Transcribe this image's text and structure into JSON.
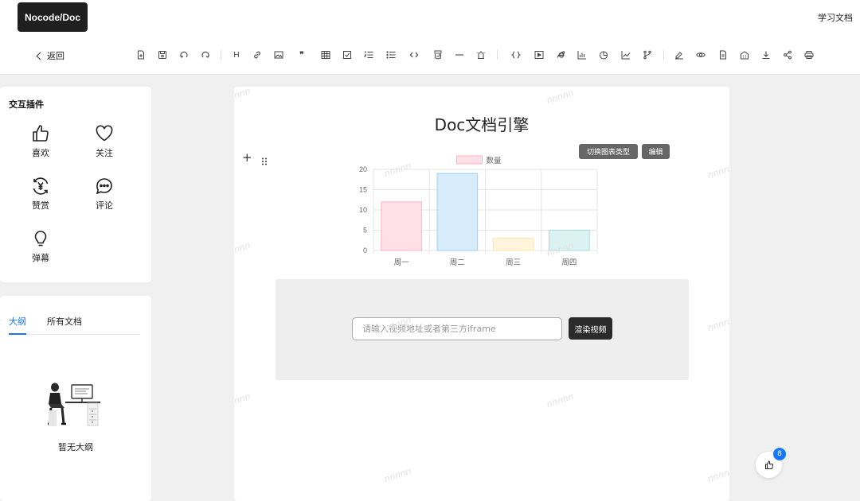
{
  "header": {
    "logo": "Nocode/Doc",
    "link": "学习文档"
  },
  "toolbar": {
    "back_label": "返回",
    "tools": [
      "new-file",
      "save",
      "undo",
      "redo",
      "heading",
      "link",
      "image",
      "quote",
      "table",
      "checklist",
      "ordered-list",
      "bullet-list",
      "code",
      "html",
      "divider",
      "alert",
      "code-block",
      "video",
      "ie",
      "bar-chart",
      "pie-chart",
      "line-chart",
      "branch",
      "sign",
      "preview",
      "doc",
      "building",
      "download",
      "share",
      "print"
    ],
    "heading_text": "H",
    "quote_text": "❞"
  },
  "plugins": {
    "title": "交互插件",
    "items": [
      {
        "label": "喜欢",
        "icon": "thumbs-up-icon"
      },
      {
        "label": "关注",
        "icon": "heart-icon"
      },
      {
        "label": "赞赏",
        "icon": "yen-coin-icon"
      },
      {
        "label": "评论",
        "icon": "comment-icon"
      },
      {
        "label": "弹幕",
        "icon": "lightbulb-icon"
      }
    ]
  },
  "outline": {
    "tabs": [
      {
        "label": "大纲",
        "active": true
      },
      {
        "label": "所有文档",
        "active": false
      }
    ],
    "empty_text": "暂无大纲"
  },
  "doc": {
    "title": "Doc文档引擎",
    "switch_chart_label": "切换图表类型",
    "edit_label": "编辑",
    "video_placeholder": "请输入视频地址或者第三方iframe",
    "render_video_label": "渲染视频",
    "watermark": "nnnnn"
  },
  "chart_data": {
    "type": "bar",
    "categories": [
      "周一",
      "周二",
      "周三",
      "周四"
    ],
    "series": [
      {
        "name": "数量",
        "values": [
          12,
          19,
          3,
          5
        ]
      }
    ],
    "ylim": [
      0,
      20
    ],
    "yticks": [
      0,
      5,
      10,
      15,
      20
    ],
    "bar_fills": [
      "#ffe0e6",
      "#d7ecfb",
      "#fff5dd",
      "#dbf2f2"
    ],
    "bar_strokes": [
      "#ffb1c1",
      "#9ad0f5",
      "#ffe6aa",
      "#a5dfdf"
    ],
    "legend_position": "top",
    "grid": true
  },
  "like_widget": {
    "count": "8"
  }
}
